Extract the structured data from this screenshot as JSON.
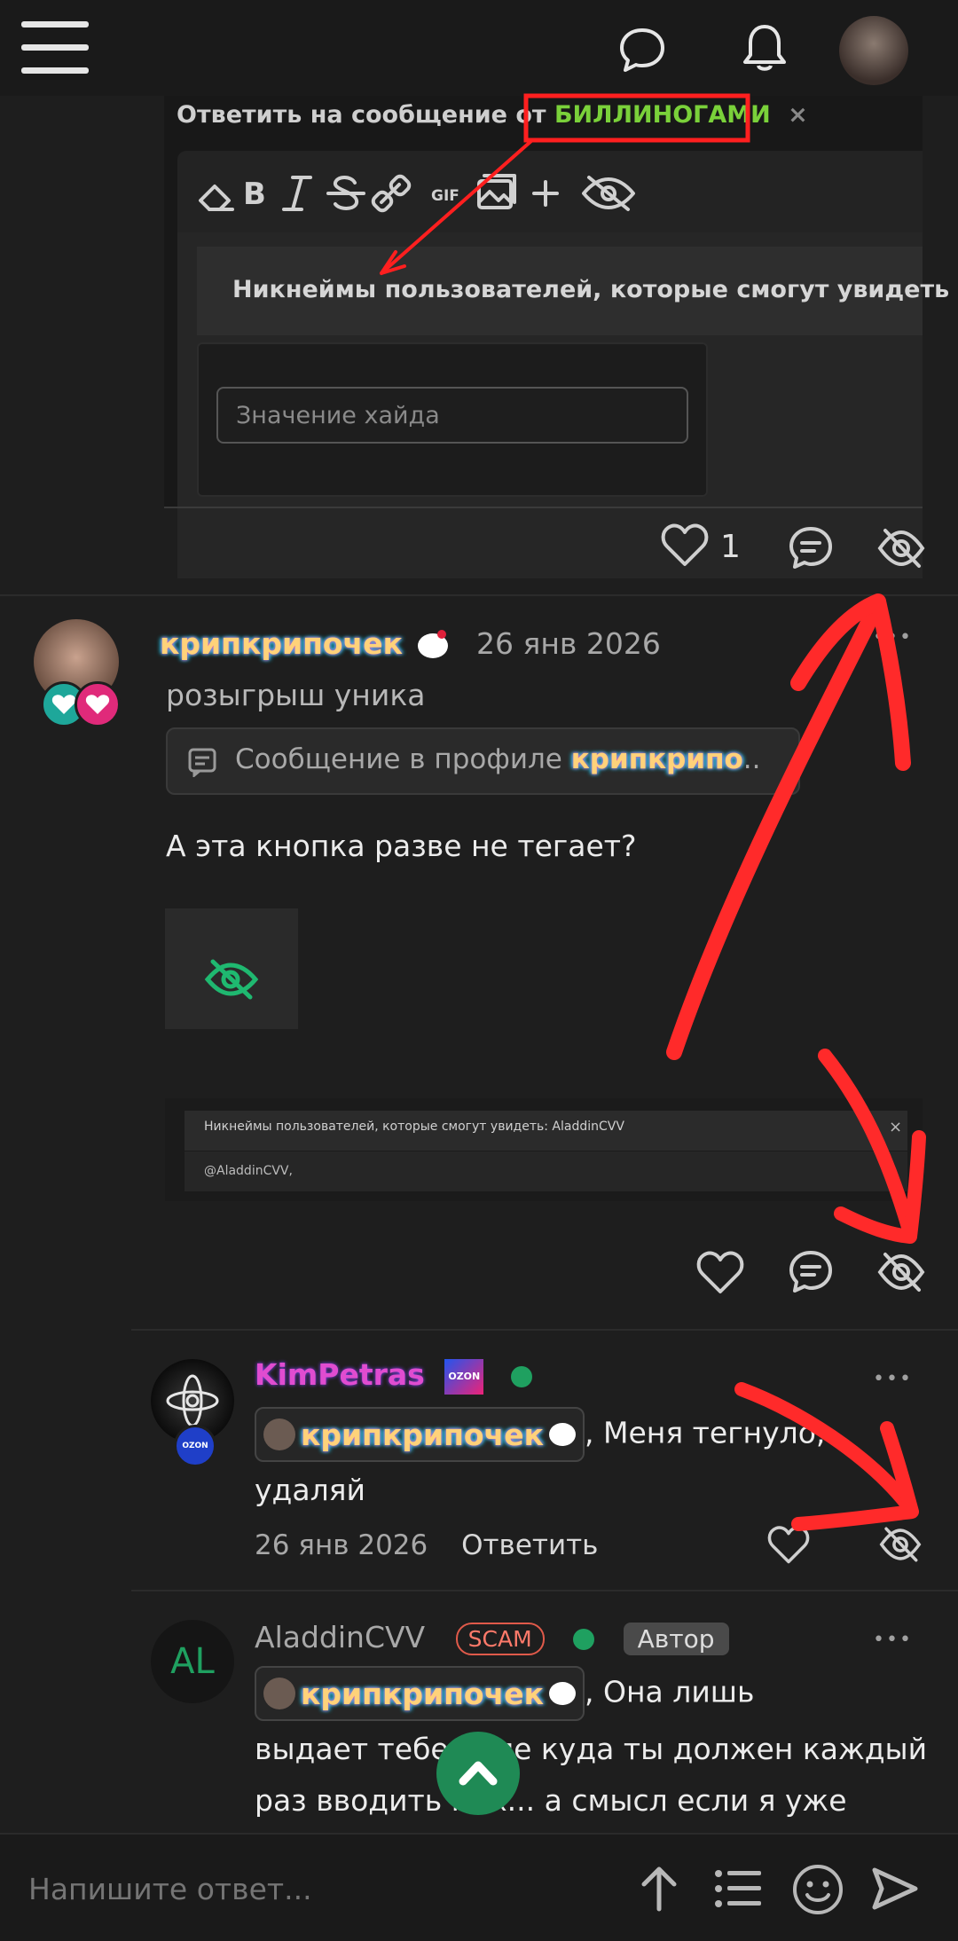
{
  "topbar": {
    "menu_icon": "menu-icon",
    "chat_icon": "chat-icon",
    "bell_icon": "bell-icon"
  },
  "embed": {
    "reply_prefix": "Ответить на сообщение от",
    "reply_user": "БИЛЛИНОГАМИ",
    "close": "×",
    "gif": "GIF",
    "hide_users_label": "Никнеймы пользователей, которые смогут увидеть",
    "hide_value_placeholder": "Значение хайда"
  },
  "post1_actions": {
    "like_count": "1"
  },
  "post2": {
    "author": "крипкрипочек",
    "date": "26 янв 2026",
    "subtitle": "розыгрыш уника",
    "quote_prefix": "Сообщение в профиле",
    "quote_user": "крипкрипо",
    "quote_suffix": "..",
    "body": "А эта кнопка разве не тегает?",
    "image_caption": "Никнеймы пользователей, которые смогут увидеть: AladdinCVV",
    "image_input": "@AladdinCVV,",
    "more": "•••"
  },
  "reply1": {
    "author": "KimPetras",
    "author_badge": "OZON",
    "avatar_badge": "OZON",
    "mention": "крипкрипочек",
    "text_part1": ", Меня тегнуло,",
    "text_part2": "удаляй",
    "date": "26 янв 2026",
    "reply_label": "Ответить",
    "more": "•••"
  },
  "reply2": {
    "avatar_initials": "AL",
    "author": "AladdinCVV",
    "scam_badge": "SCAM",
    "author_badge": "Автор",
    "mention": "крипкрипочек",
    "text_part1": ", Она лишь",
    "text_part2": "выдает тебе поле куда ты должен каждый",
    "text_part3": "раз вводить ник... а смысл если я уже",
    "more": "•••"
  },
  "composer": {
    "placeholder": "Напишите ответ..."
  },
  "colors": {
    "background": "#1e1e1e",
    "accent_green": "#1fa060",
    "annotation_red": "#ff1f1f",
    "highlight_green": "#7ad13a"
  }
}
